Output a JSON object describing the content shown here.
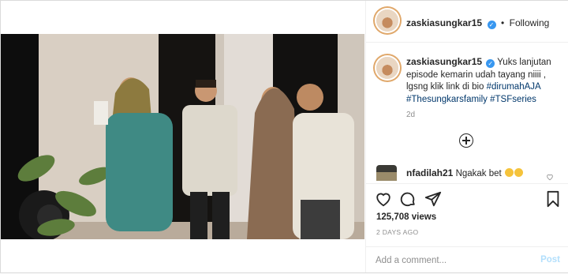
{
  "header": {
    "username": "zaskiasungkar15",
    "follow_status": "Following",
    "separator": "•"
  },
  "caption": {
    "username": "zaskiasungkar15",
    "text": "Yuks lanjutan episode kemarin udah tayang niiii , lgsng klik link di bio",
    "hashtags": [
      "#dirumahAJA",
      "#Thesungkarsfamily",
      "#TSFseries"
    ],
    "time": "2d"
  },
  "comment": {
    "username": "nfadilah21",
    "text": "Ngakak bet"
  },
  "stats": {
    "views": "125,708 views",
    "posted": "2 DAYS AGO"
  },
  "add_comment": {
    "placeholder": "Add a comment...",
    "post_label": "Post"
  },
  "icons": {
    "verified": "verified-badge-icon",
    "load_more": "plus-circle-icon",
    "like": "heart-icon",
    "comment": "comment-bubble-icon",
    "share": "paper-plane-icon",
    "save": "bookmark-icon"
  },
  "colors": {
    "link": "#00376b",
    "verified": "#3897f0",
    "muted": "#8e8e8e",
    "post_button": "#b2dffc"
  }
}
